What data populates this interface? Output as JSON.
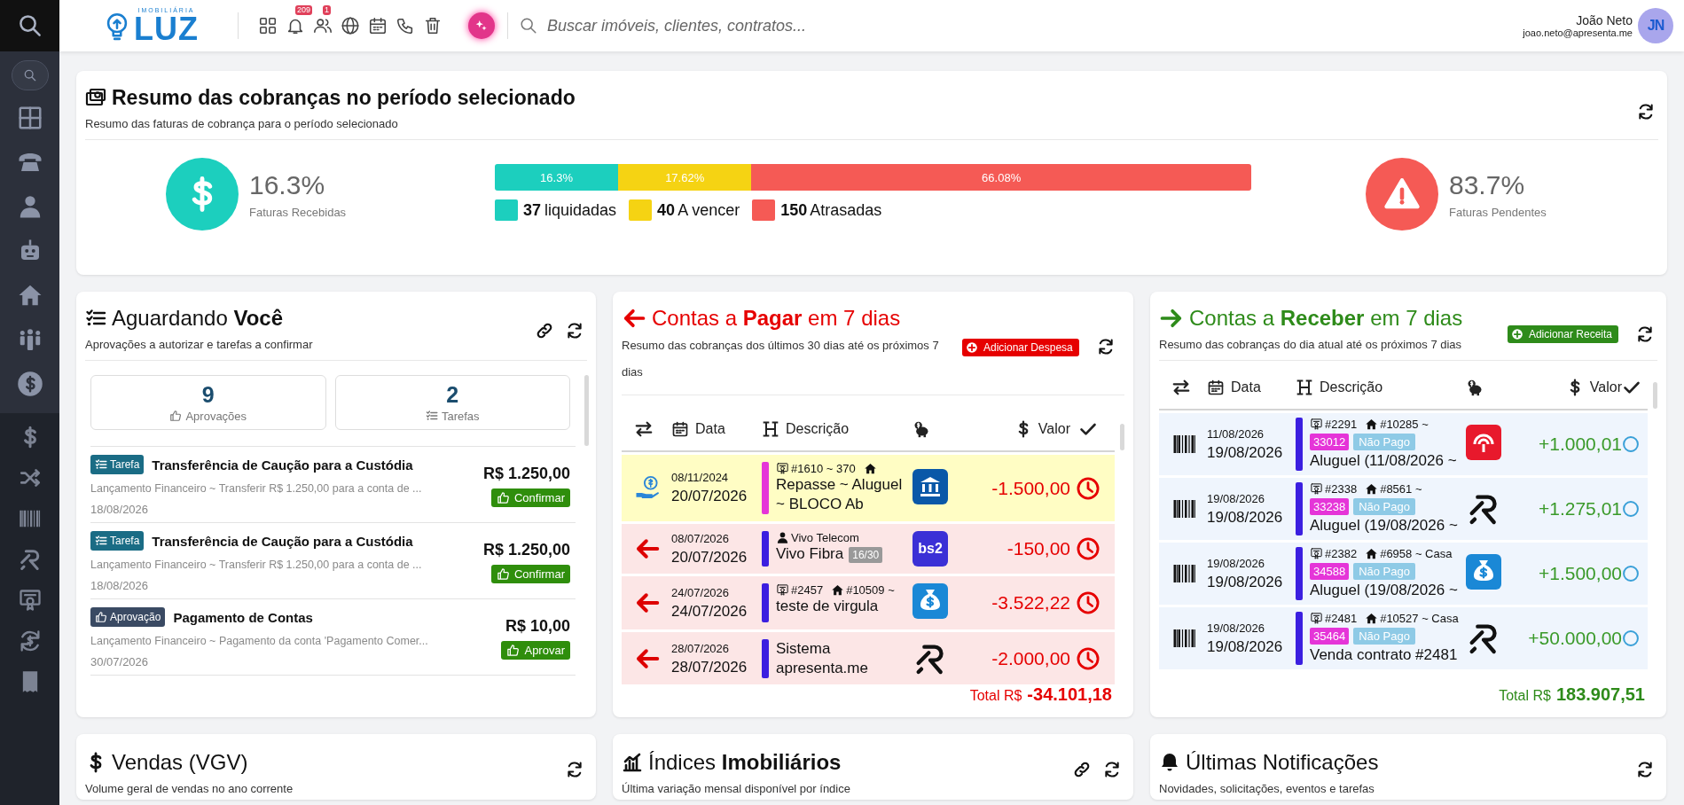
{
  "topbar": {
    "logo": {
      "tagline": "IMOBILIÁRIA",
      "name": "LUZ"
    },
    "notifications_badge": "209",
    "users_badge": "1",
    "search": {
      "placeholder": "Buscar imóveis, clientes, contratos..."
    },
    "user": {
      "name": "João Neto",
      "email": "joao.neto@apresenta.me",
      "initials": "JN"
    }
  },
  "summary": {
    "title": "Resumo das cobranças no período selecionado",
    "subtitle": "Resumo das faturas de cobrança para o período selecionado",
    "received": {
      "percent": "16.3%",
      "label": "Faturas Recebidas"
    },
    "segments": [
      {
        "label": "16.3%",
        "color": "#1ccfbe"
      },
      {
        "label": "17.62%",
        "color": "#f5d313"
      },
      {
        "label": "66.08%",
        "color": "#f55a55"
      }
    ],
    "legend": [
      {
        "count": "37",
        "label": "liquidadas",
        "color": "#1ccfbe"
      },
      {
        "count": "40",
        "label": "A vencer",
        "color": "#f5d313"
      },
      {
        "count": "150",
        "label": "Atrasadas",
        "color": "#f55a55"
      }
    ],
    "pending": {
      "percent": "83.7%",
      "label": "Faturas Pendentes"
    }
  },
  "waiting": {
    "title": "Aguardando **Você**",
    "subtitle": "Aprovações a autorizar e tarefas a confirmar",
    "stats": [
      {
        "kind": "approvals",
        "count": "9",
        "label": "Aprovações"
      },
      {
        "kind": "tasks",
        "count": "2",
        "label": "Tarefas"
      }
    ],
    "items": [
      {
        "kind": "task",
        "badge": "Tarefa",
        "title": "Transferência de Caução para a Custódia",
        "detail": "Lançamento Financeiro ~ Transferir R$ 1.250,00 para a conta de ...",
        "date": "18/08/2026",
        "amount": "R$ 1.250,00",
        "action": "Confirmar"
      },
      {
        "kind": "task",
        "badge": "Tarefa",
        "title": "Transferência de Caução para a Custódia",
        "detail": "Lançamento Financeiro ~ Transferir R$ 1.250,00 para a conta de ...",
        "date": "18/08/2026",
        "amount": "R$ 1.250,00",
        "action": "Confirmar"
      },
      {
        "kind": "approval",
        "badge": "Aprovação",
        "title": "Pagamento de Contas",
        "detail": "Lançamento Financeiro ~ Pagamento da conta 'Pagamento Comer...",
        "date": "30/07/2026",
        "amount": "R$ 10,00",
        "action": "Aprovar"
      }
    ]
  },
  "payables": {
    "title": "Contas a **Pagar** em 7 dias",
    "subtitle": "Resumo das cobranças dos últimos 30 dias até os próximos 7 dias",
    "add_button": "Adicionar Despesa",
    "columns": [
      "Data",
      "Descrição",
      "Valor"
    ],
    "rows": [
      {
        "kind": "transfer",
        "date_small": "08/11/2024",
        "date": "20/07/2026",
        "color": "#e535d8",
        "tags": [
          {
            "kind": "contract",
            "text": "#1610 ~ 370"
          },
          {
            "kind": "home"
          }
        ],
        "description": "Repasse ~ Aluguel ~ BLOCO Ab",
        "bank": {
          "kind": "bank"
        },
        "value": "-1.500,00"
      },
      {
        "kind": "expense",
        "date_small": "08/07/2026",
        "date": "20/07/2026",
        "color": "#3b1fe0",
        "tags": [
          {
            "kind": "person",
            "text": "Vivo Telecom"
          }
        ],
        "description": "Vivo Fibra",
        "installment": "16/30",
        "bank": {
          "kind": "bs2",
          "label": "bs2"
        },
        "value": "-150,00"
      },
      {
        "kind": "expense",
        "date_small": "24/07/2026",
        "date": "24/07/2026",
        "color": "#3b1fe0",
        "tags": [
          {
            "kind": "contract",
            "text": "#2457"
          },
          {
            "kind": "home",
            "text": "#10509 ~"
          }
        ],
        "description": "teste de virgula",
        "bank": {
          "kind": "money-bag"
        },
        "value": "-3.522,22"
      },
      {
        "kind": "expense",
        "date_small": "28/07/2026",
        "date": "28/07/2026",
        "color": "#3b1fe0",
        "tags": [],
        "description": "Sistema apresenta.me",
        "bank": {
          "kind": "r-logo"
        },
        "value": "-2.000,00"
      }
    ],
    "total_label": "Total R$",
    "total": "-34.101,18"
  },
  "receivables": {
    "title": "Contas a **Receber** em 7 dias",
    "subtitle": "Resumo das cobranças do dia atual até os próximos 7 dias",
    "add_button": "Adicionar Receita",
    "columns": [
      "Data",
      "Descrição",
      "Valor"
    ],
    "rows": [
      {
        "kind": "boleto",
        "date_small": "11/08/2026",
        "date": "19/08/2026",
        "color": "#3b1fe0",
        "tags": [
          {
            "kind": "contract",
            "text": "#2291"
          },
          {
            "kind": "home",
            "text": "#10285 ~"
          }
        ],
        "code": "33012",
        "status": "Não Pago",
        "description": "Aluguel (11/08/2026 ~",
        "bank": {
          "kind": "red"
        },
        "value": "+1.000,01"
      },
      {
        "kind": "boleto",
        "date_small": "19/08/2026",
        "date": "19/08/2026",
        "color": "#3b1fe0",
        "tags": [
          {
            "kind": "contract",
            "text": "#2338"
          },
          {
            "kind": "home",
            "text": "#8561 ~"
          }
        ],
        "code": "33238",
        "status": "Não Pago",
        "description": "Aluguel (19/08/2026 ~",
        "bank": {
          "kind": "r-logo"
        },
        "value": "+1.275,01"
      },
      {
        "kind": "boleto",
        "date_small": "19/08/2026",
        "date": "19/08/2026",
        "color": "#3b1fe0",
        "tags": [
          {
            "kind": "contract",
            "text": "#2382"
          },
          {
            "kind": "home",
            "text": "#6958 ~ Casa"
          }
        ],
        "code": "34588",
        "status": "Não Pago",
        "description": "Aluguel (19/08/2026 ~",
        "bank": {
          "kind": "money-bag"
        },
        "value": "+1.500,00"
      },
      {
        "kind": "boleto",
        "date_small": "19/08/2026",
        "date": "19/08/2026",
        "color": "#3b1fe0",
        "tags": [
          {
            "kind": "contract",
            "text": "#2481"
          },
          {
            "kind": "home",
            "text": "#10527 ~ Casa"
          }
        ],
        "code": "35464",
        "status": "Não Pago",
        "description": "Venda contrato #2481",
        "bank": {
          "kind": "r-logo"
        },
        "value": "+50.000,00"
      }
    ],
    "total_label": "Total R$",
    "total": "183.907,51"
  },
  "bottom_cards": [
    {
      "kind": "sales",
      "title": "Vendas (VGV)",
      "subtitle": "Volume geral de vendas no ano corrente"
    },
    {
      "kind": "indices",
      "title": "Índices **Imobiliários**",
      "subtitle": "Última variação mensal disponível por índice"
    },
    {
      "kind": "notifications",
      "title": "Últimas Notificações",
      "subtitle": "Novidades, solicitações, eventos e tarefas"
    }
  ]
}
